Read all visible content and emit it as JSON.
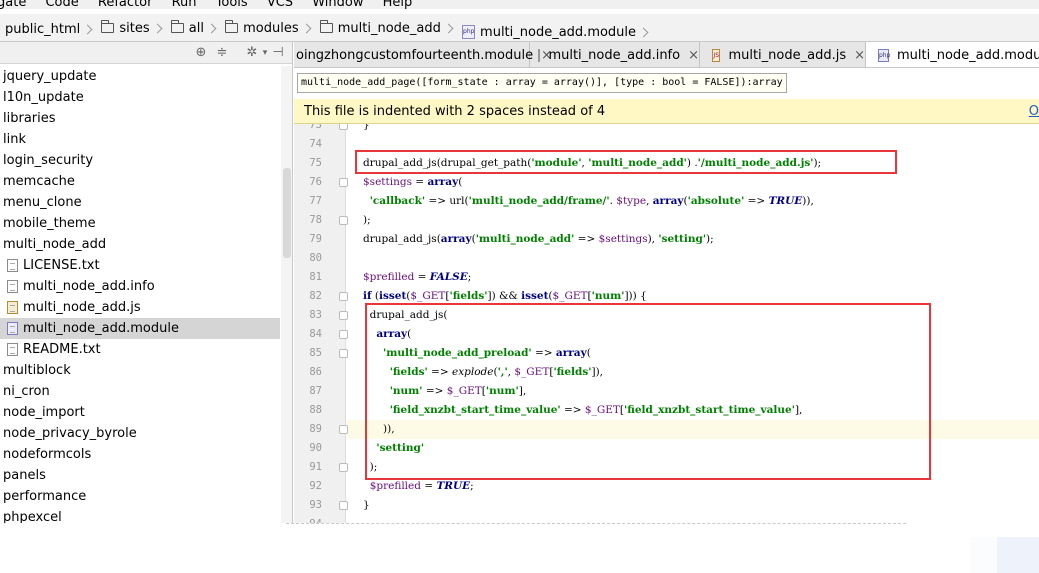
{
  "menubar": {
    "items": [
      "gate",
      "Code",
      "Refactor",
      "Run",
      "Tools",
      "VCS",
      "Window",
      "Help"
    ]
  },
  "breadcrumbs": [
    {
      "label": "public_html",
      "icon": "folder-icon"
    },
    {
      "label": "sites",
      "icon": "folder-icon"
    },
    {
      "label": "all",
      "icon": "folder-icon"
    },
    {
      "label": "modules",
      "icon": "folder-icon"
    },
    {
      "label": "multi_node_add",
      "icon": "folder-icon"
    },
    {
      "label": "multi_node_add.module",
      "icon": "php-file-icon"
    }
  ],
  "sidebar": {
    "toolbar_icons": [
      "locate-icon",
      "collapse-icon",
      "gear-icon",
      "hide-icon"
    ],
    "items": [
      {
        "label": "jquery_update",
        "type": "folder"
      },
      {
        "label": "l10n_update",
        "type": "folder"
      },
      {
        "label": "libraries",
        "type": "folder"
      },
      {
        "label": "link",
        "type": "folder"
      },
      {
        "label": "login_security",
        "type": "folder"
      },
      {
        "label": "memcache",
        "type": "folder"
      },
      {
        "label": "menu_clone",
        "type": "folder"
      },
      {
        "label": "mobile_theme",
        "type": "folder"
      },
      {
        "label": "multi_node_add",
        "type": "folder"
      },
      {
        "label": "LICENSE.txt",
        "type": "file",
        "icon": "txt"
      },
      {
        "label": "multi_node_add.info",
        "type": "file",
        "icon": "txt"
      },
      {
        "label": "multi_node_add.js",
        "type": "file",
        "icon": "js"
      },
      {
        "label": "multi_node_add.module",
        "type": "file",
        "icon": "php",
        "selected": true
      },
      {
        "label": "README.txt",
        "type": "file",
        "icon": "txt"
      },
      {
        "label": "multiblock",
        "type": "folder"
      },
      {
        "label": "ni_cron",
        "type": "folder"
      },
      {
        "label": "node_import",
        "type": "folder"
      },
      {
        "label": "node_privacy_byrole",
        "type": "folder"
      },
      {
        "label": "nodeformcols",
        "type": "folder"
      },
      {
        "label": "panels",
        "type": "folder"
      },
      {
        "label": "performance",
        "type": "folder"
      },
      {
        "label": "phpexcel",
        "type": "folder"
      }
    ]
  },
  "tabs": [
    {
      "label": "oingzhongcustomfourteenth.module",
      "icon": "none",
      "close": "×"
    },
    {
      "label": "multi_node_add.info",
      "icon": "txt",
      "close": "×"
    },
    {
      "label": "multi_node_add.js",
      "icon": "js",
      "close": "×"
    },
    {
      "label": "multi_node_add.module",
      "icon": "php",
      "active": true
    }
  ],
  "hint": "multi_node_add_page([form_state : array = array()], [type : bool = FALSE]):array",
  "notice": {
    "text": "This file is indented with 2 spaces instead of 4",
    "link": "O"
  },
  "code": {
    "lines": [
      {
        "no": "73",
        "text": "}"
      },
      {
        "no": "74",
        "text": ""
      },
      {
        "no": "75",
        "text": "drupal_add_js(drupal_get_path('module', 'multi_node_add') .'/multi_node_add.js');"
      },
      {
        "no": "76",
        "text": "$settings = array("
      },
      {
        "no": "77",
        "text": "  'callback' => url('multi_node_add/frame/'. $type, array('absolute' => TRUE)),"
      },
      {
        "no": "78",
        "text": ");"
      },
      {
        "no": "79",
        "text": "drupal_add_js(array('multi_node_add' => $settings), 'setting');"
      },
      {
        "no": "80",
        "text": ""
      },
      {
        "no": "81",
        "text": "$prefilled = FALSE;"
      },
      {
        "no": "82",
        "text": "if (isset($_GET['fields']) && isset($_GET['num'])) {"
      },
      {
        "no": "83",
        "text": "  drupal_add_js("
      },
      {
        "no": "84",
        "text": "    array("
      },
      {
        "no": "85",
        "text": "      'multi_node_add_preload' => array("
      },
      {
        "no": "86",
        "text": "        'fields' => explode(',', $_GET['fields']),"
      },
      {
        "no": "87",
        "text": "        'num' => $_GET['num'],"
      },
      {
        "no": "88",
        "text": "        'field_xnzbt_start_time_value' => $_GET['field_xnzbt_start_time_value'],"
      },
      {
        "no": "89",
        "text": "      )),"
      },
      {
        "no": "90",
        "text": "    'setting'"
      },
      {
        "no": "91",
        "text": "  );"
      },
      {
        "no": "92",
        "text": "  $prefilled = TRUE;"
      },
      {
        "no": "93",
        "text": "}"
      },
      {
        "no": "94",
        "text": ""
      }
    ]
  },
  "colors": {
    "highlight_box": "#e8363a",
    "notice_bg": "#fff8c4",
    "string": "#008000",
    "keyword": "#000080",
    "variable": "#660e7a"
  }
}
